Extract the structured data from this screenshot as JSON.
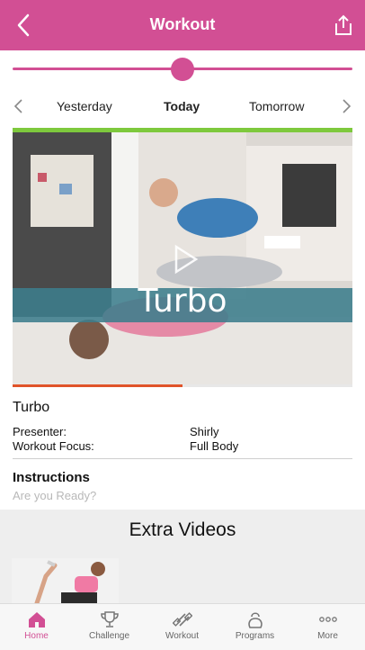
{
  "header": {
    "title": "Workout",
    "back_icon": "chevron-left-icon",
    "share_icon": "share-icon",
    "background": "#d24f94"
  },
  "slider": {
    "value_fraction": 0.5
  },
  "day_nav": {
    "yesterday": "Yesterday",
    "today": "Today",
    "tomorrow": "Tomorrow"
  },
  "video": {
    "banner_text": "Turbo",
    "progress_fraction": 0.5,
    "accent_top": "#7ec93d",
    "progress_color": "#e0542a"
  },
  "workout": {
    "name": "Turbo",
    "presenter_label": "Presenter:",
    "presenter_value": "Shirly",
    "focus_label": "Workout Focus:",
    "focus_value": "Full Body"
  },
  "instructions": {
    "title": "Instructions",
    "text": "Are you Ready?"
  },
  "extra_videos": {
    "title": "Extra Videos"
  },
  "tabs": [
    {
      "label": "Home",
      "icon": "home-icon",
      "active": true
    },
    {
      "label": "Challenge",
      "icon": "trophy-icon",
      "active": false
    },
    {
      "label": "Workout",
      "icon": "dumbbell-icon",
      "active": false
    },
    {
      "label": "Programs",
      "icon": "kettlebell-icon",
      "active": false
    },
    {
      "label": "More",
      "icon": "more-icon",
      "active": false
    }
  ]
}
